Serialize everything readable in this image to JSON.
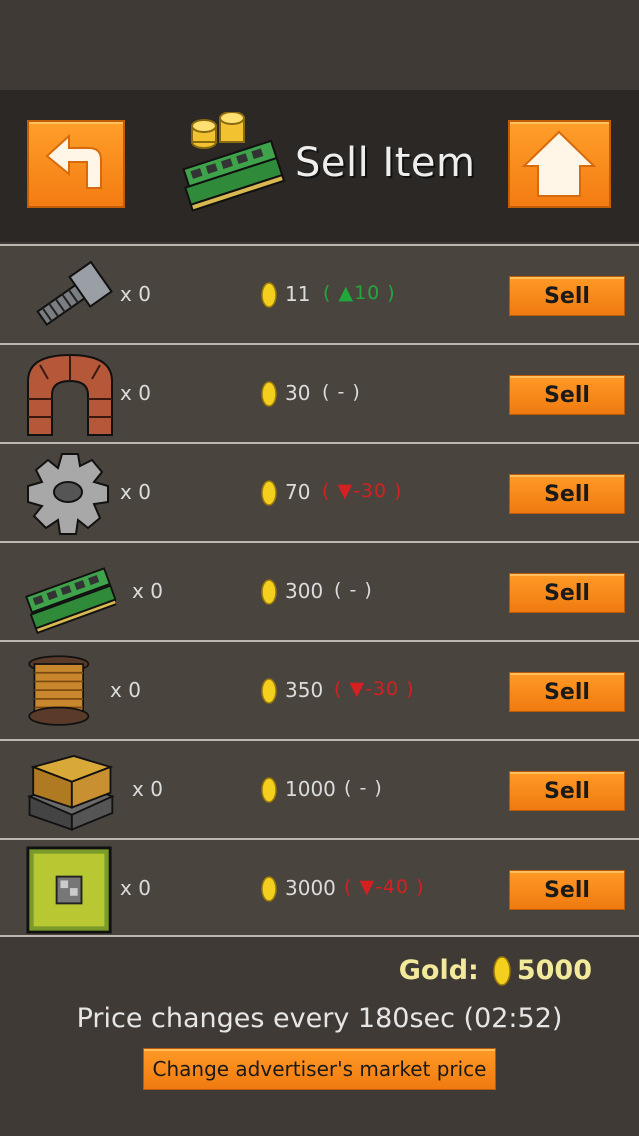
{
  "header": {
    "title": "Sell Item",
    "back_icon": "back-arrow-icon",
    "home_icon": "home-up-arrow-icon",
    "title_icon": "coins-and-ram-icon"
  },
  "items": [
    {
      "icon": "bolt-icon",
      "count": "x 0",
      "price": "11",
      "change": "( ▲10 )",
      "trend": "up",
      "sell_label": "Sell"
    },
    {
      "icon": "brick-arch-icon",
      "count": "x 0",
      "price": "30",
      "change": "( - )",
      "trend": "flat",
      "sell_label": "Sell"
    },
    {
      "icon": "gear-icon",
      "count": "x 0",
      "price": "70",
      "change": "( ▼-30 )",
      "trend": "down",
      "sell_label": "Sell"
    },
    {
      "icon": "ram-stick-icon",
      "count": "x 0",
      "price": "300",
      "change": "( - )",
      "trend": "flat",
      "sell_label": "Sell"
    },
    {
      "icon": "copper-spool-icon",
      "count": "x 0",
      "price": "350",
      "change": "( ▼-30 )",
      "trend": "down",
      "sell_label": "Sell"
    },
    {
      "icon": "server-rack-icon",
      "count": "x 0",
      "price": "1000",
      "change": "( - )",
      "trend": "flat",
      "sell_label": "Sell"
    },
    {
      "icon": "cpu-chip-icon",
      "count": "x 0",
      "price": "3000",
      "change": "( ▼-40 )",
      "trend": "down",
      "sell_label": "Sell"
    }
  ],
  "footer": {
    "gold_label": "Gold:",
    "gold_value": "5000",
    "timer_text": "Price changes every 180sec (02:52)",
    "market_button": "Change advertiser's market price"
  },
  "colors": {
    "accent": "#f7891a",
    "up": "#22a83a",
    "down": "#d42020",
    "gold_text": "#f2e99a"
  }
}
